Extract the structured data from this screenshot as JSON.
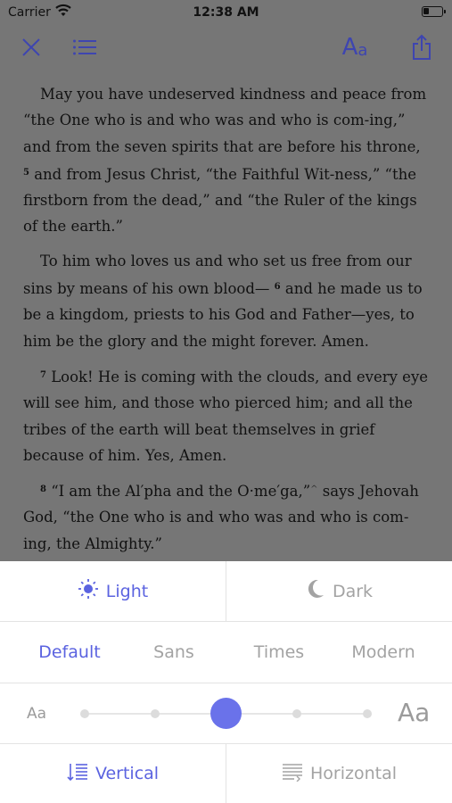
{
  "status": {
    "carrier": "Carrier",
    "time": "12:38 AM"
  },
  "toolbar": {
    "font_settings_label_big": "A",
    "font_settings_label_small": "a"
  },
  "reader": {
    "paragraphs": [
      {
        "verse": "",
        "text": "May you have undeserved kindness and peace from “the One who is and who was and who is com-ing,” and from the seven spirits that are before his throne, ",
        "verse_after": "5",
        "text_after": " and from Jesus Christ, “the Faithful Wit-ness,” “the firstborn from the dead,” and “the Ruler of the kings of the earth.”"
      },
      {
        "verse": "",
        "text": "To him who loves us and who set us free from our sins by means of his own blood— ",
        "verse_after": "6",
        "text_after": " and he made us to be a kingdom, priests to his God and Father—yes, to him be the glory and the might forever. Amen."
      },
      {
        "verse": "7",
        "text": " Look! He is coming with the clouds, and every eye will see him, and those who pierced him; and all the tribes of the earth will beat themselves in grief because of him. Yes, Amen.",
        "verse_after": "",
        "text_after": ""
      },
      {
        "verse": "8",
        "text": " “I am the Al′pha and the O·me′ga,”",
        "verse_after": "^",
        "text_after": " says Jehovah God, “the One who is and who was and who is com-ing, the Almighty.”"
      }
    ]
  },
  "settings": {
    "theme_light": "Light",
    "theme_dark": "Dark",
    "fonts": [
      "Default",
      "Sans",
      "Times",
      "Modern"
    ],
    "font_selected": "Default",
    "size_small": "Aa",
    "size_large": "Aa",
    "text_size_step": 3,
    "text_size_steps": 5,
    "layout_vertical": "Vertical",
    "layout_horizontal": "Horizontal",
    "accent_color": "#5b63e0"
  }
}
